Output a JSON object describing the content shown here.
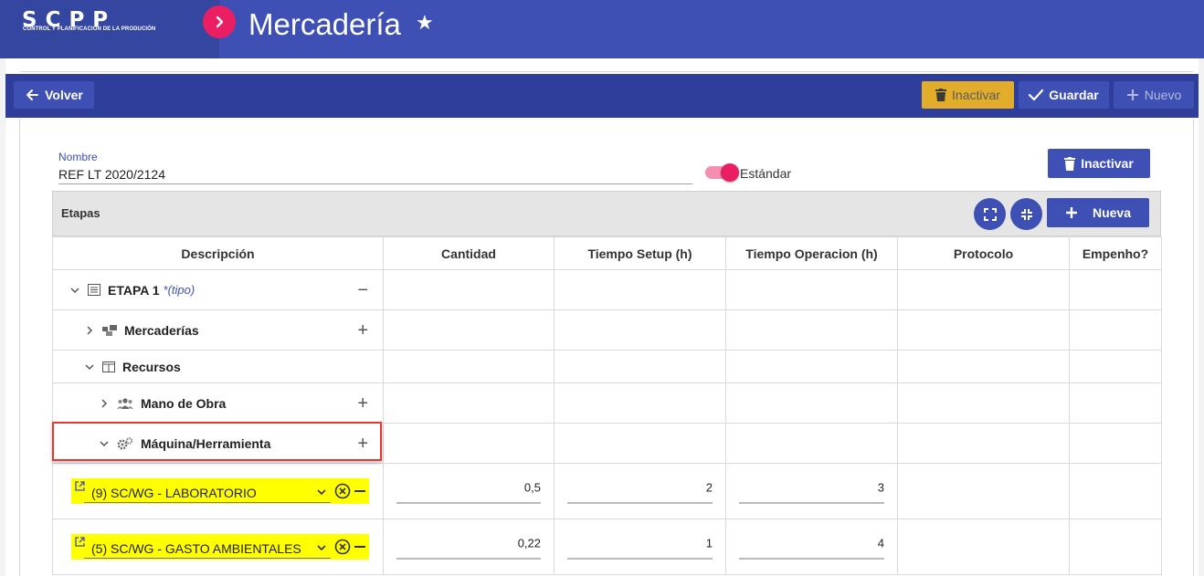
{
  "app": {
    "logo": "SCPP",
    "logo_subtitle": "CONTROL Y PLANIFICACIÓN DE LA PRODUCIÓN",
    "page_title": "Mercadería",
    "brand_color": "#3e50b4",
    "accent_color": "#e91e63"
  },
  "toolbar": {
    "back_label": "Volver",
    "inactivate_label": "Inactivar",
    "save_label": "Guardar",
    "new_label": "Nuevo"
  },
  "form": {
    "name_label": "Nombre",
    "name_value": "REF LT 2020/2124",
    "standard_label": "Estándar",
    "standard_on": true,
    "inactivate_label": "Inactivar"
  },
  "stages": {
    "title": "Etapas",
    "new_label": "Nueva",
    "columns": [
      "Descripción",
      "Cantidad",
      "Tiempo Setup (h)",
      "Tiempo Operacion (h)",
      "Protocolo",
      "Empenho?"
    ],
    "tree": {
      "stage": {
        "label": "ETAPA 1",
        "type_hint": "*(tipo)"
      },
      "goods": {
        "label": "Mercaderías"
      },
      "resources": {
        "label": "Recursos"
      },
      "labor": {
        "label": "Mano de Obra"
      },
      "machine": {
        "label": "Máquina/Herramienta"
      }
    },
    "machine_rows": [
      {
        "resource": "(9) SC/WG - LABORATORIO",
        "cantidad": "0,5",
        "setup": "2",
        "operacion": "3"
      },
      {
        "resource": "(5) SC/WG - GASTO AMBIENTALES",
        "cantidad": "0,22",
        "setup": "1",
        "operacion": "4"
      }
    ]
  }
}
